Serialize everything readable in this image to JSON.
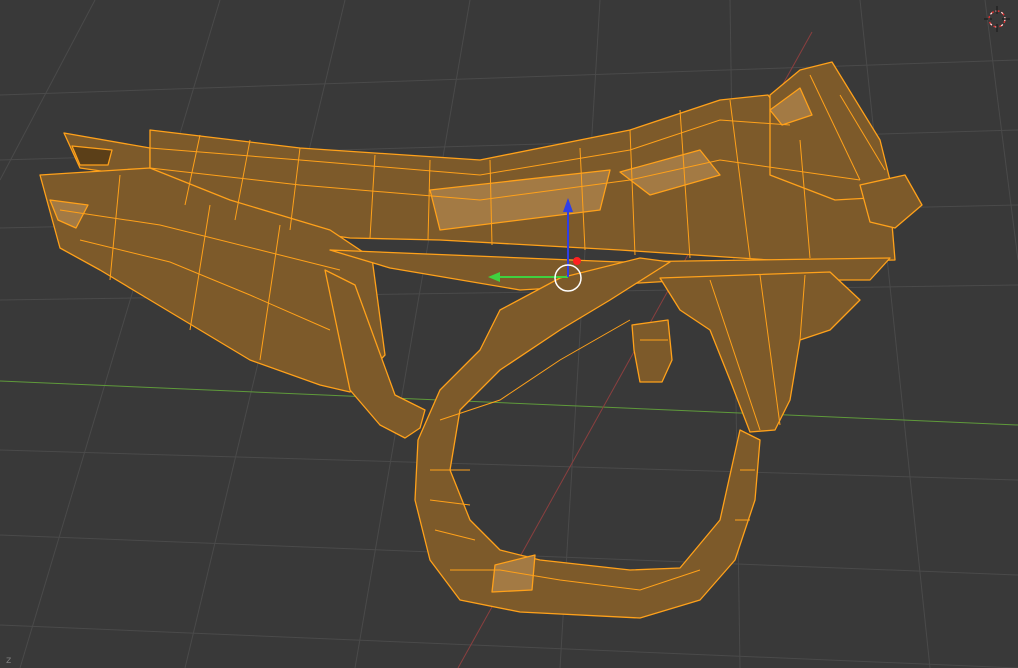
{
  "viewport": {
    "mode": "Edit Mode",
    "shading": "Solid",
    "background": "#393939",
    "grid_color": "#4a4a4a",
    "x_axis_color": "#5f9a3b",
    "y_axis_color": "#8a3f3f",
    "mesh_face_color": "#7d5a2a",
    "mesh_edge_color": "#ffa11a"
  },
  "gizmo": {
    "x_axis_color": "#3fd13f",
    "z_axis_color": "#2f3fe6",
    "origin_color": "#ff2020",
    "pivot_ring_color": "#ffffff"
  },
  "view_navigator": {
    "icon": "crosshair-icon"
  },
  "corner_label": "z"
}
